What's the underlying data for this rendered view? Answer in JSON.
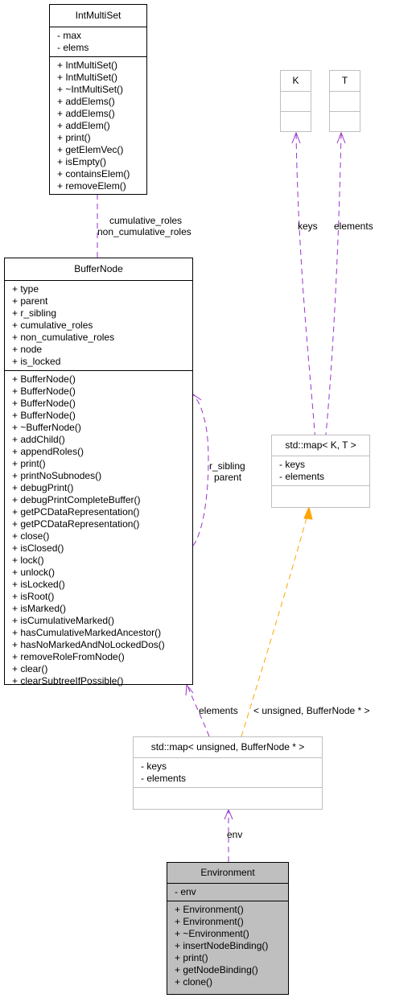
{
  "classes": {
    "intmultiset": {
      "name": "IntMultiSet",
      "attributes": [
        "- max",
        "- elems"
      ],
      "methods": [
        "+ IntMultiSet()",
        "+ IntMultiSet()",
        "+ ~IntMultiSet()",
        "+ addElems()",
        "+ addElems()",
        "+ addElem()",
        "+ print()",
        "+ getElemVec()",
        "+ isEmpty()",
        "+ containsElem()",
        "+ removeElem()"
      ]
    },
    "buffernode": {
      "name": "BufferNode",
      "attributes": [
        "+ type",
        "+ parent",
        "+ r_sibling",
        "+ cumulative_roles",
        "+ non_cumulative_roles",
        "+ node",
        "+ is_locked"
      ],
      "methods": [
        "+ BufferNode()",
        "+ BufferNode()",
        "+ BufferNode()",
        "+ BufferNode()",
        "+ ~BufferNode()",
        "+ addChild()",
        "+ appendRoles()",
        "+ print()",
        "+ printNoSubnodes()",
        "+ debugPrint()",
        "+ debugPrintCompleteBuffer()",
        "+ getPCDataRepresentation()",
        "+ getPCDataRepresentation()",
        "+ close()",
        "+ isClosed()",
        "+ lock()",
        "+ unlock()",
        "+ isLocked()",
        "+ isRoot()",
        "+ isMarked()",
        "+ isCumulativeMarked()",
        "+ hasCumulativeMarkedAncestor()",
        "+ hasNoMarkedAndNoLockedDos()",
        "+ removeRoleFromNode()",
        "+ clear()",
        "+ clearSubtreeIfPossible()"
      ]
    },
    "k": {
      "name": "K"
    },
    "t": {
      "name": "T"
    },
    "stdmap_template": {
      "name": "std::map< K, T >",
      "attributes": [
        "- keys",
        "- elements"
      ]
    },
    "stdmap_instance": {
      "name": "std::map< unsigned, BufferNode * >",
      "attributes": [
        "- keys",
        "- elements"
      ]
    },
    "environment": {
      "name": "Environment",
      "attributes": [
        "- env"
      ],
      "methods": [
        "+ Environment()",
        "+ Environment()",
        "+ ~Environment()",
        "+ insertNodeBinding()",
        "+ print()",
        "+ getNodeBinding()",
        "+ clone()"
      ]
    }
  },
  "edge_labels": {
    "roles_1": "cumulative_roles",
    "roles_2": "non_cumulative_roles",
    "keys": "keys",
    "elements_t": "elements",
    "r_sibling": "r_sibling",
    "parent": "parent",
    "elements_bn": "elements",
    "template_args": "< unsigned, BufferNode * >",
    "env": "env"
  },
  "colors": {
    "usage_edge": "#9a32cd",
    "template_edge": "#ffa500",
    "highlight_fill": "#bfbfbf"
  }
}
